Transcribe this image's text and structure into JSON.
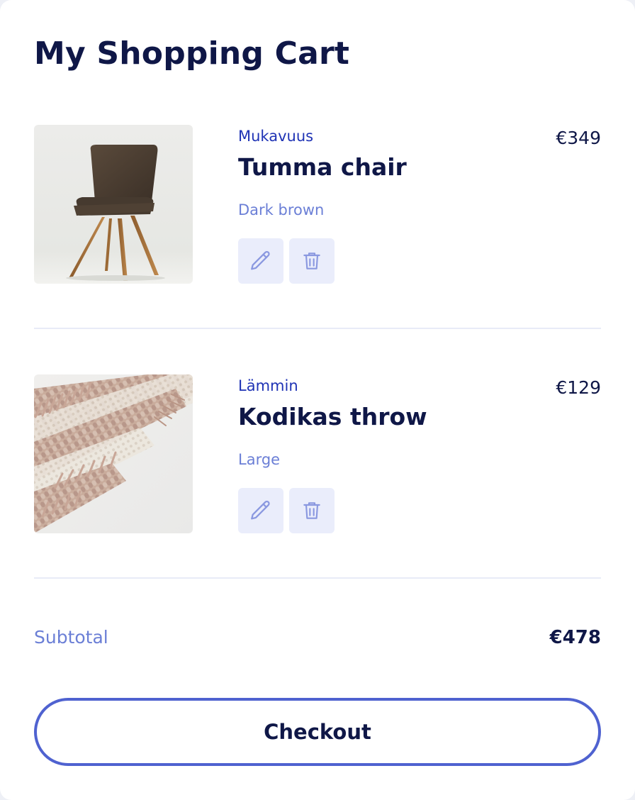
{
  "page_title": "My Shopping Cart",
  "items": [
    {
      "brand": "Mukavuus",
      "name": "Tumma chair",
      "variant": "Dark brown",
      "price": "€349",
      "image_icon": "chair-photo"
    },
    {
      "brand": "Lämmin",
      "name": "Kodikas throw",
      "variant": "Large",
      "price": "€129",
      "image_icon": "throw-photo"
    }
  ],
  "subtotal": {
    "label": "Subtotal",
    "value": "€478"
  },
  "checkout_label": "Checkout",
  "icons": {
    "edit": "pencil-icon",
    "delete": "trash-icon"
  },
  "colors": {
    "title": "#0f1747",
    "brand": "#1f33b5",
    "muted": "#6b7fd6",
    "icon_button_bg": "#eaedfb",
    "icon_stroke": "#8a98e0",
    "checkout_border": "#4f62d0",
    "divider": "#e8ebf7"
  }
}
